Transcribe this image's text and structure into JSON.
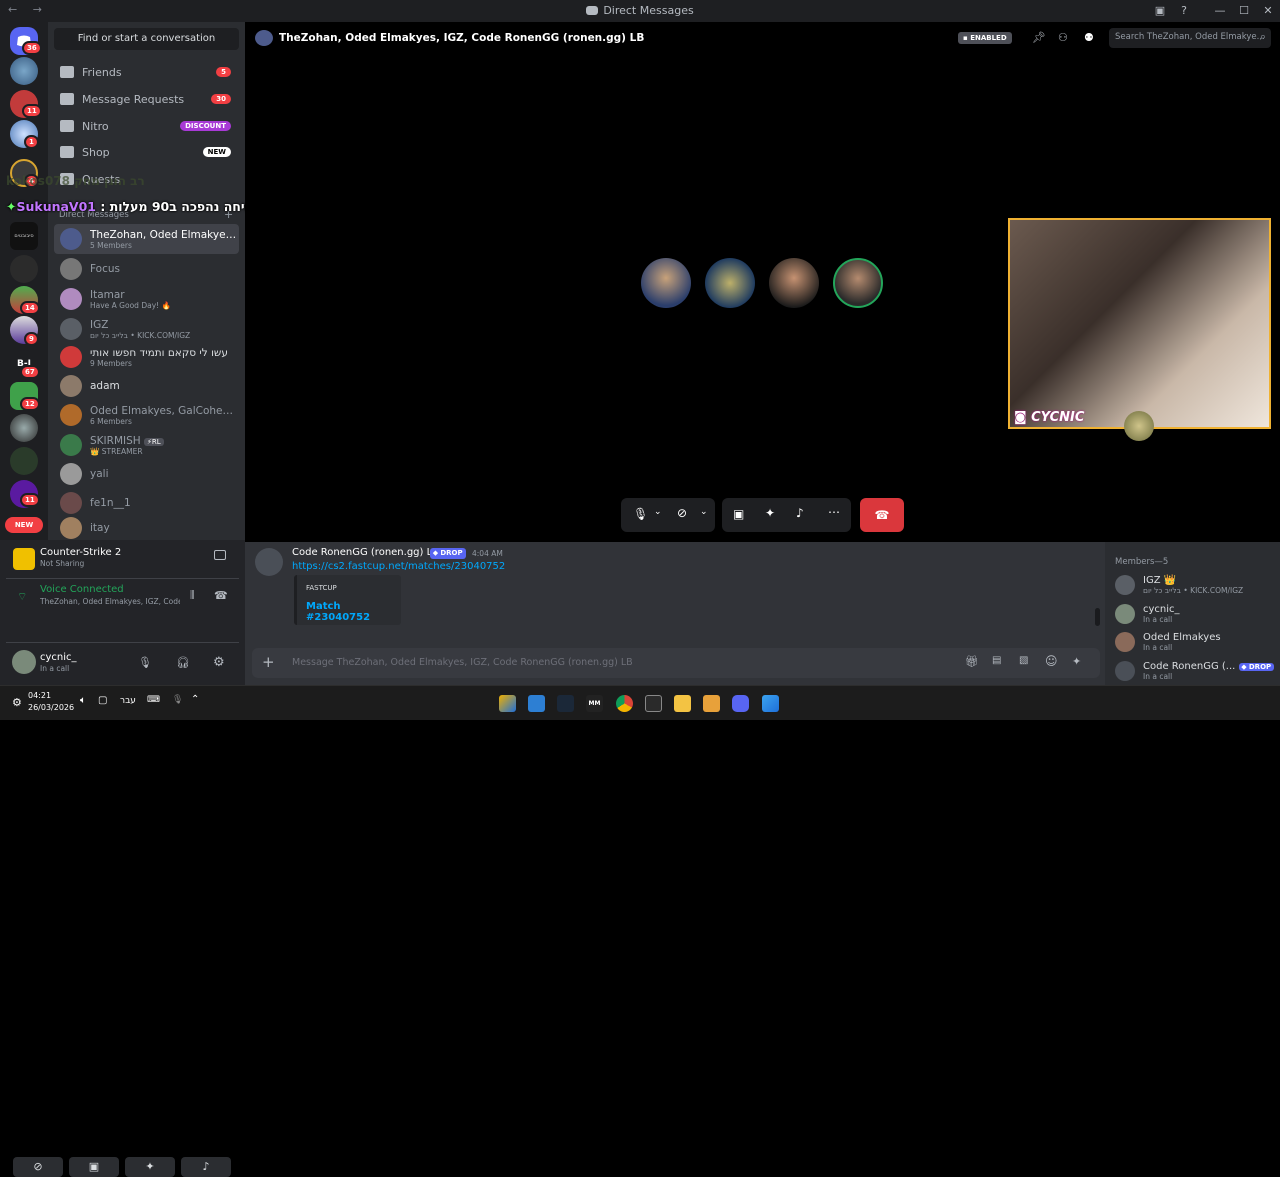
{
  "titlebar": {
    "title": "Direct Messages",
    "nav": "← →"
  },
  "rail": {
    "badges": [
      "36",
      "11",
      "1",
      "4",
      "14",
      "9",
      "67",
      "12",
      "11"
    ],
    "new_label": "NEW",
    "server_text": "סיבובטים",
    "server_text2": "B-I"
  },
  "sidebar": {
    "find": "Find or start a conversation",
    "nav": [
      {
        "label": "Friends",
        "badge": "5"
      },
      {
        "label": "Message Requests",
        "badge": "30"
      },
      {
        "label": "Nitro",
        "badge": "DISCOUNT"
      },
      {
        "label": "Shop",
        "badge": "NEW"
      },
      {
        "label": "Quests"
      }
    ],
    "dm_header": "Direct Messages",
    "dms": [
      {
        "name": "TheZohan, Oded Elmakyes, IG...",
        "sub": "5 Members"
      },
      {
        "name": "Focus",
        "sub": ""
      },
      {
        "name": "Itamar",
        "sub": "Have A Good Day! 🔥"
      },
      {
        "name": "IGZ",
        "sub": "בלייב כל יום • KICK.COM/IGZ"
      },
      {
        "name": "עשו לי סקאם ותמיד חפשו אותי",
        "sub": "9 Members"
      },
      {
        "name": "adam",
        "sub": ""
      },
      {
        "name": "Oded Elmakyes, GalCohen, SK...",
        "sub": "6 Members"
      },
      {
        "name": "SKIRMISH",
        "tag": "⚡RL",
        "sub": "👑 STREAMER"
      },
      {
        "name": "yali",
        "sub": ""
      },
      {
        "name": "fe1n__1",
        "sub": ""
      },
      {
        "name": "itay",
        "sub": ""
      }
    ]
  },
  "overlay": {
    "ghost": "kokos078 רב הוגן מחק",
    "user": "SukunaV01",
    "message": "אבל כן השיחה נהפכה ב90 מעלות :"
  },
  "activity": {
    "game": "Counter-Strike 2",
    "status": "Not Sharing"
  },
  "voice": {
    "title": "Voice Connected",
    "channel": "TheZohan, Oded Elmakyes, IGZ, Code ..."
  },
  "user": {
    "name": "cycnic_",
    "status": "In a call"
  },
  "call": {
    "title": "TheZohan, Oded Elmakyes, IGZ, Code RonenGG (ronen.gg) LB",
    "enabled": "ENABLED",
    "search_placeholder": "Search TheZohan, Oded Elmakye...",
    "stream_name": "CYCNIC"
  },
  "message": {
    "author": "Code RonenGG (ronen.gg) LB",
    "tag": "DROP",
    "time": "4:04 AM",
    "link": "https://cs2.fastcup.net/matches/23040752",
    "embed_provider": "FASTCUP",
    "embed_title": "Match #23040752",
    "input_placeholder": "Message TheZohan, Oded Elmakyes, IGZ, Code RonenGG (ronen.gg) LB"
  },
  "members": {
    "header": "Members—5",
    "list": [
      {
        "name": "IGZ 👑",
        "sub": "בלייב כל יום • KICK.COM/IGZ"
      },
      {
        "name": "cycnic_",
        "sub": "In a call"
      },
      {
        "name": "Oded Elmakyes",
        "sub": "In a call"
      },
      {
        "name": "Code RonenGG (...",
        "tag": "DROP",
        "sub": "In a call"
      }
    ]
  },
  "taskbar": {
    "time": "04:21",
    "date": "26/03/2026",
    "lang": "עבר"
  },
  "colors": {
    "accent": "#5865f2",
    "danger": "#da373c",
    "online": "#23a55a",
    "link": "#00a8fc",
    "nitro": "#a83ad6"
  }
}
